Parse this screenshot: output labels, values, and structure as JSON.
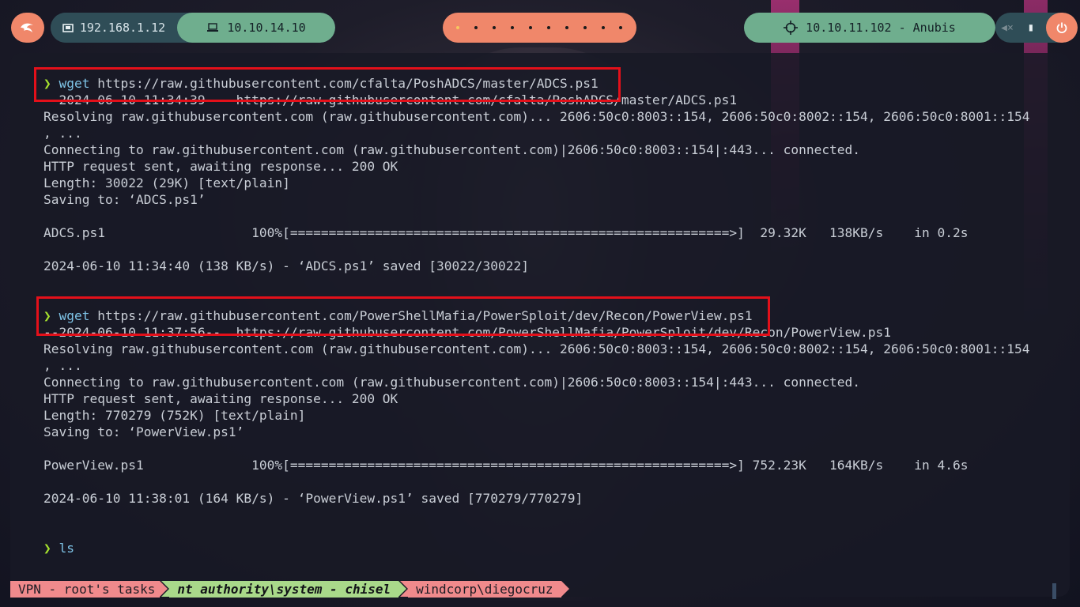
{
  "topbar": {
    "local_ip": "192.168.1.12",
    "vpn_ip": "10.10.14.10",
    "target": "10.10.11.102 - Anubis",
    "workspace_count": 10,
    "active_workspace": 1
  },
  "terminal": {
    "lines": [
      {
        "type": "cmd",
        "prompt": "❯",
        "cmd": "wget",
        "arg": " https://raw.githubusercontent.com/cfalta/PoshADCS/master/ADCS.ps1"
      },
      {
        "type": "out",
        "text": "--2024-06-10 11:34:39--  https://raw.githubusercontent.com/cfalta/PoshADCS/master/ADCS.ps1"
      },
      {
        "type": "out",
        "text": "Resolving raw.githubusercontent.com (raw.githubusercontent.com)... 2606:50c0:8003::154, 2606:50c0:8002::154, 2606:50c0:8001::154"
      },
      {
        "type": "out",
        "text": ", ..."
      },
      {
        "type": "out",
        "text": "Connecting to raw.githubusercontent.com (raw.githubusercontent.com)|2606:50c0:8003::154|:443... connected."
      },
      {
        "type": "out",
        "text": "HTTP request sent, awaiting response... 200 OK"
      },
      {
        "type": "out",
        "text": "Length: 30022 (29K) [text/plain]"
      },
      {
        "type": "out",
        "text": "Saving to: ‘ADCS.ps1’"
      },
      {
        "type": "out",
        "text": ""
      },
      {
        "type": "out",
        "text": "ADCS.ps1                   100%[=========================================================>]  29.32K   138KB/s    in 0.2s"
      },
      {
        "type": "out",
        "text": ""
      },
      {
        "type": "out",
        "text": "2024-06-10 11:34:40 (138 KB/s) - ‘ADCS.ps1’ saved [30022/30022]"
      },
      {
        "type": "out",
        "text": ""
      },
      {
        "type": "out",
        "text": ""
      },
      {
        "type": "cmd",
        "prompt": "❯",
        "cmd": "wget",
        "arg": " https://raw.githubusercontent.com/PowerShellMafia/PowerSploit/dev/Recon/PowerView.ps1"
      },
      {
        "type": "out",
        "text": "--2024-06-10 11:37:56--  https://raw.githubusercontent.com/PowerShellMafia/PowerSploit/dev/Recon/PowerView.ps1"
      },
      {
        "type": "out",
        "text": "Resolving raw.githubusercontent.com (raw.githubusercontent.com)... 2606:50c0:8003::154, 2606:50c0:8002::154, 2606:50c0:8001::154"
      },
      {
        "type": "out",
        "text": ", ..."
      },
      {
        "type": "out",
        "text": "Connecting to raw.githubusercontent.com (raw.githubusercontent.com)|2606:50c0:8003::154|:443... connected."
      },
      {
        "type": "out",
        "text": "HTTP request sent, awaiting response... 200 OK"
      },
      {
        "type": "out",
        "text": "Length: 770279 (752K) [text/plain]"
      },
      {
        "type": "out",
        "text": "Saving to: ‘PowerView.ps1’"
      },
      {
        "type": "out",
        "text": ""
      },
      {
        "type": "out",
        "text": "PowerView.ps1              100%[=========================================================>] 752.23K   164KB/s    in 4.6s"
      },
      {
        "type": "out",
        "text": ""
      },
      {
        "type": "out",
        "text": "2024-06-10 11:38:01 (164 KB/s) - ‘PowerView.ps1’ saved [770279/770279]"
      },
      {
        "type": "out",
        "text": ""
      },
      {
        "type": "out",
        "text": ""
      },
      {
        "type": "cmd",
        "prompt": "❯",
        "cmd": "ls",
        "arg": ""
      }
    ]
  },
  "tabs": [
    "VPN - root's tasks",
    "nt authority\\system - chisel",
    "windcorp\\diegocruz"
  ],
  "colors": {
    "highlight": "#e3101a",
    "prompt": "#a6e22e",
    "command": "#7ec3e6",
    "accent_orange": "#f0876a",
    "accent_green": "#6fae8e"
  }
}
